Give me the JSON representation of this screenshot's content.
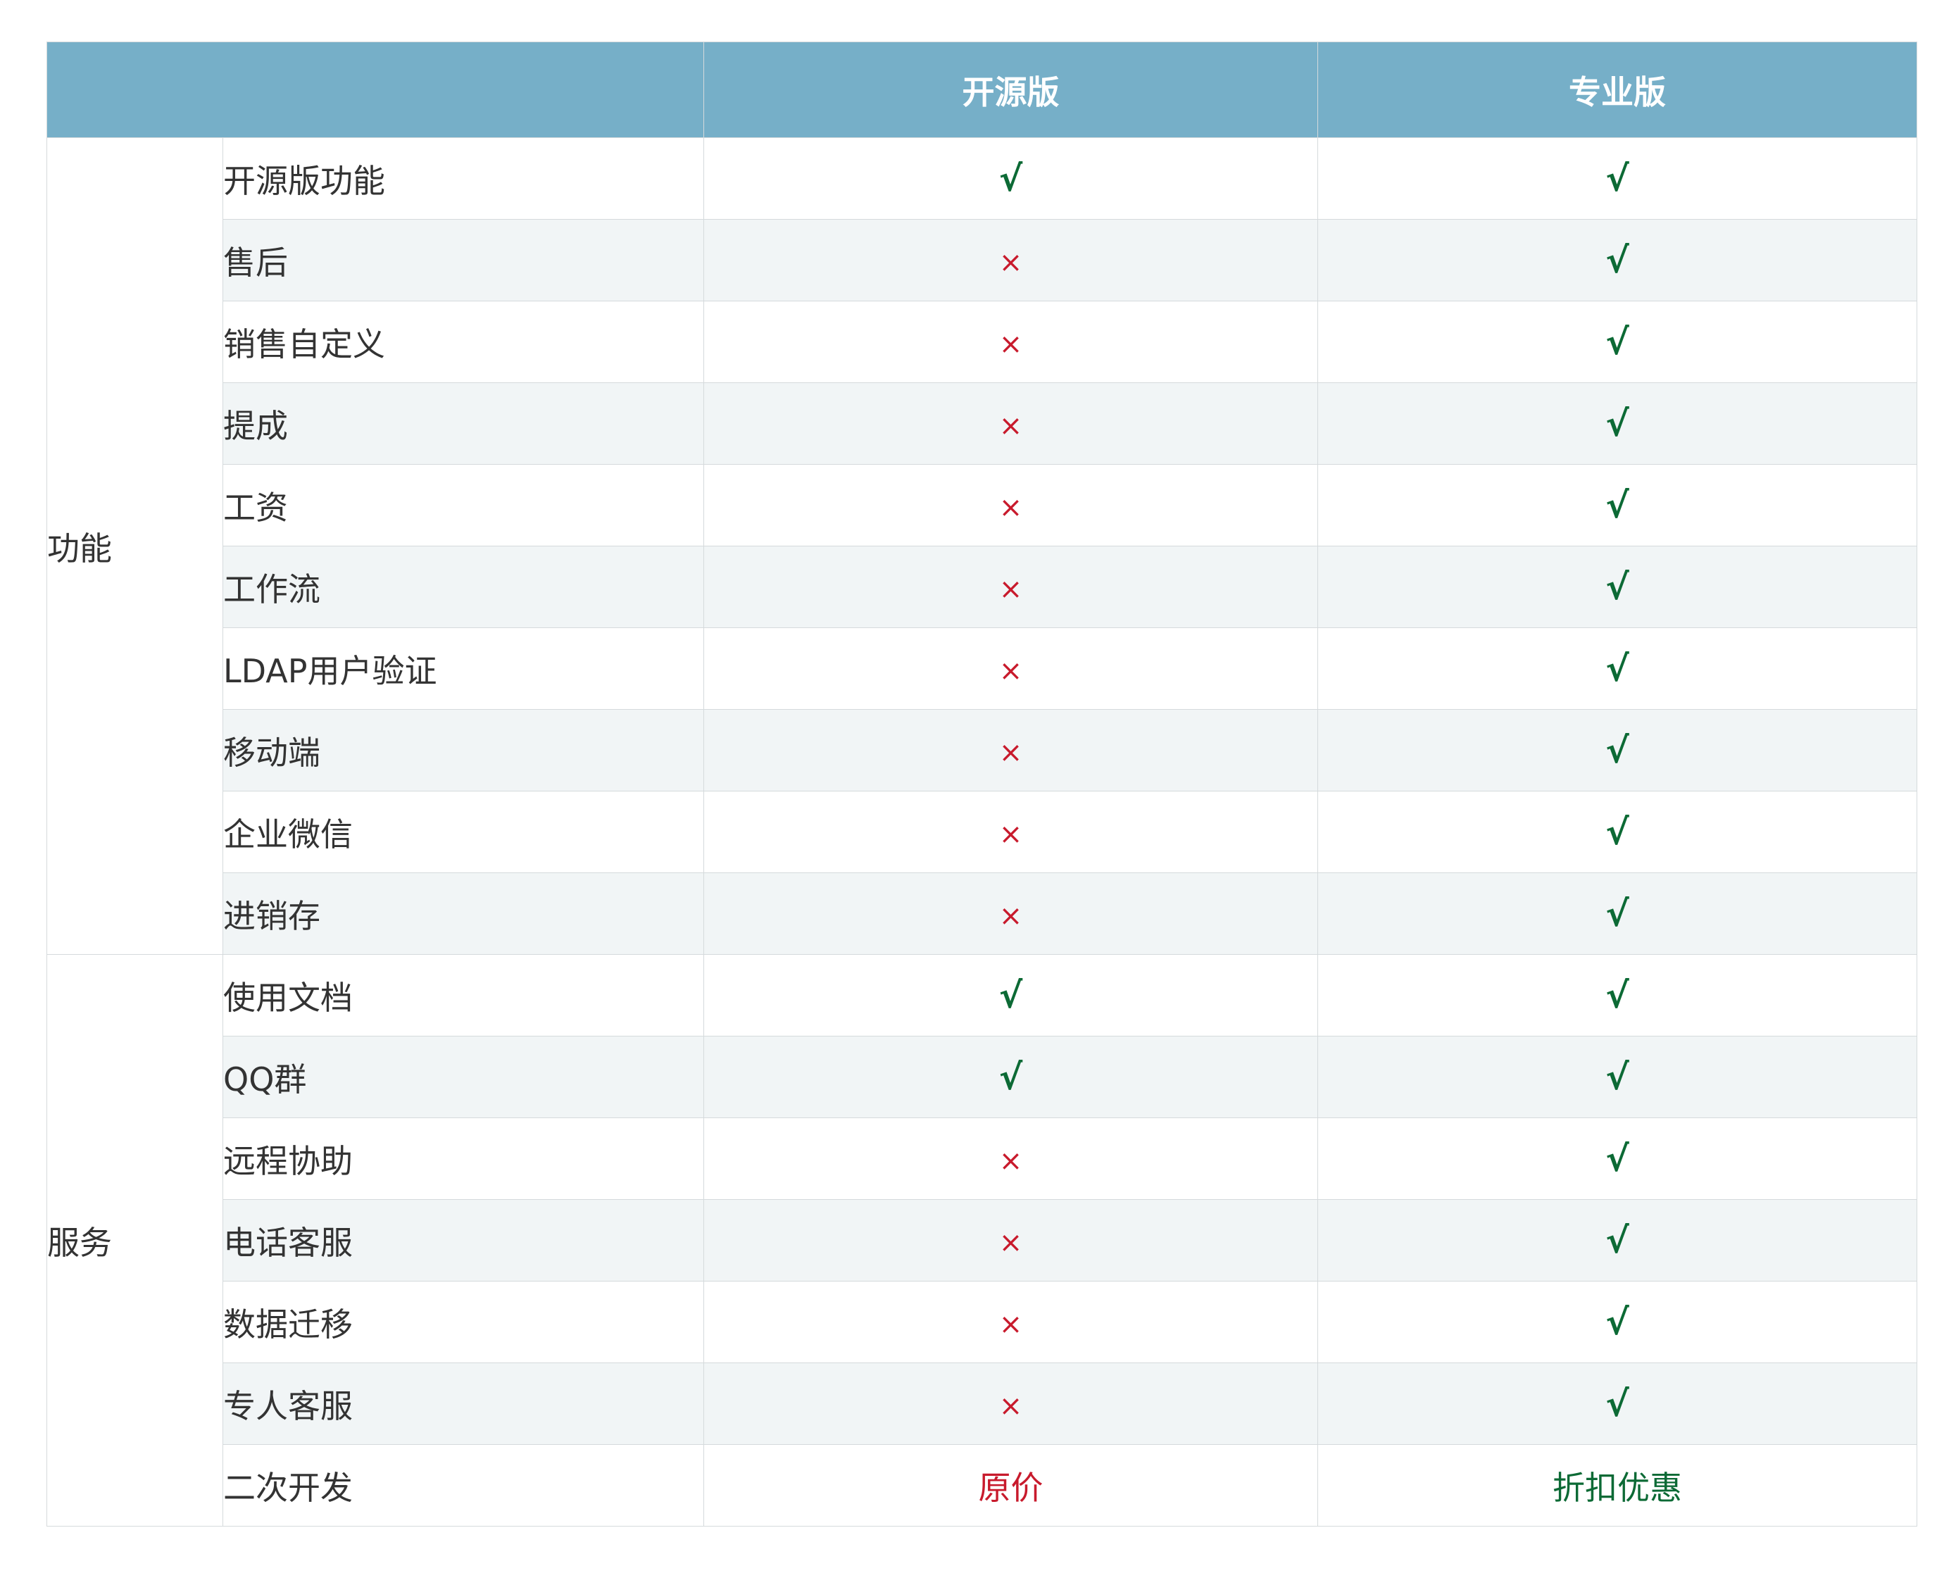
{
  "colors": {
    "header_bg": "#76afc8",
    "alt_row_bg": "#f1f5f6",
    "yes_green": "#0c6a35",
    "no_red": "#c81a2c"
  },
  "header": {
    "blank": "",
    "open_label": "开源版",
    "pro_label": "专业版"
  },
  "groups": {
    "features_label": "功能",
    "services_label": "服务"
  },
  "rows": [
    {
      "feature": "开源版功能",
      "open": "√",
      "pro": "√"
    },
    {
      "feature": "售后",
      "open": "×",
      "pro": "√"
    },
    {
      "feature": "销售自定义",
      "open": "×",
      "pro": "√"
    },
    {
      "feature": "提成",
      "open": "×",
      "pro": "√"
    },
    {
      "feature": "工资",
      "open": "×",
      "pro": "√"
    },
    {
      "feature": "工作流",
      "open": "×",
      "pro": "√"
    },
    {
      "feature": "LDAP用户验证",
      "open": "×",
      "pro": "√"
    },
    {
      "feature": "移动端",
      "open": "×",
      "pro": "√"
    },
    {
      "feature": "企业微信",
      "open": "×",
      "pro": "√"
    },
    {
      "feature": "进销存",
      "open": "×",
      "pro": "√"
    },
    {
      "feature": "使用文档",
      "open": "√",
      "pro": "√"
    },
    {
      "feature": "QQ群",
      "open": "√",
      "pro": "√"
    },
    {
      "feature": "远程协助",
      "open": "×",
      "pro": "√"
    },
    {
      "feature": "电话客服",
      "open": "×",
      "pro": "√"
    },
    {
      "feature": "数据迁移",
      "open": "×",
      "pro": "√"
    },
    {
      "feature": "专人客服",
      "open": "×",
      "pro": "√"
    },
    {
      "feature": "二次开发",
      "open": "原价",
      "pro": "折扣优惠"
    }
  ]
}
